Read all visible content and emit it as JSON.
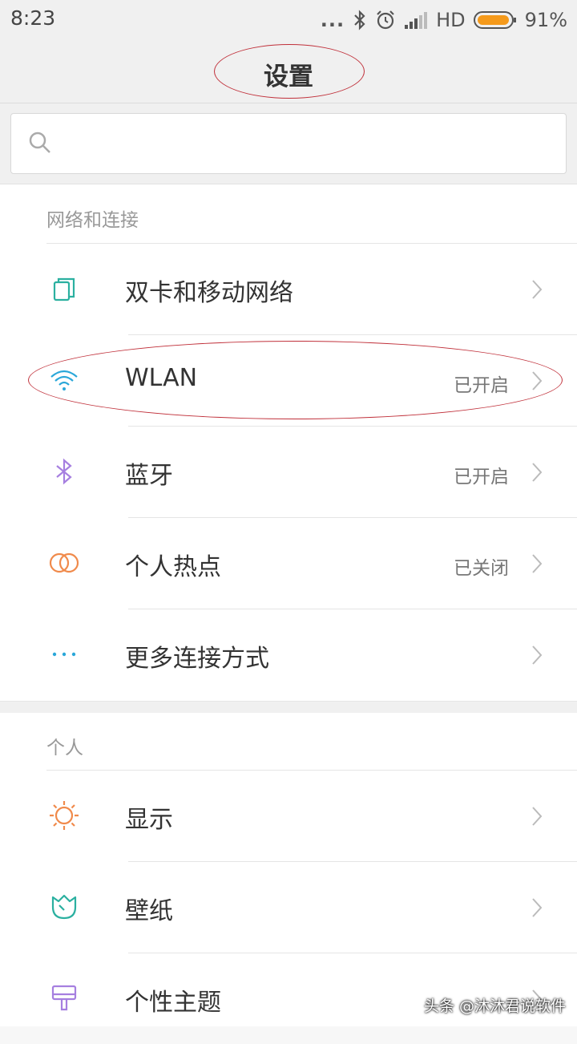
{
  "status_bar": {
    "time": "8:23",
    "dots": "...",
    "network": "HD",
    "battery": "91%",
    "battery_color": "#f59a1b"
  },
  "header": {
    "title": "设置"
  },
  "search": {
    "placeholder": ""
  },
  "sections": [
    {
      "header": "网络和连接",
      "items": [
        {
          "label": "双卡和移动网络",
          "value": "",
          "icon": "sim-card-icon",
          "color": "#2bb0a0"
        },
        {
          "label": "WLAN",
          "value": "已开启",
          "icon": "wifi-icon",
          "color": "#2aa7d9"
        },
        {
          "label": "蓝牙",
          "value": "已开启",
          "icon": "bluetooth-icon",
          "color": "#a67fe0"
        },
        {
          "label": "个人热点",
          "value": "已关闭",
          "icon": "hotspot-icon",
          "color": "#f08a4b"
        },
        {
          "label": "更多连接方式",
          "value": "",
          "icon": "more-icon",
          "color": "#2aa7d9"
        }
      ]
    },
    {
      "header": "个人",
      "items": [
        {
          "label": "显示",
          "value": "",
          "icon": "sun-icon",
          "color": "#f08a4b"
        },
        {
          "label": "壁纸",
          "value": "",
          "icon": "flower-icon",
          "color": "#2bb0a0"
        },
        {
          "label": "个性主题",
          "value": "",
          "icon": "brush-icon",
          "color": "#a67fe0"
        }
      ]
    }
  ],
  "watermark": "头条 @沐沐君说软件"
}
